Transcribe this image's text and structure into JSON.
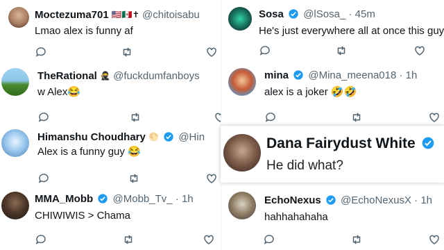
{
  "colors": {
    "verified": "#1d9bf0",
    "icon": "#536471",
    "text": "#0f1419",
    "muted": "#536471"
  },
  "tweets": [
    {
      "name": "Moctezuma701",
      "flags": "🇺🇸🇲🇽✝",
      "handle": "@chitoisabu",
      "time": "",
      "text": "Lmao alex is funny af",
      "verified": false
    },
    {
      "name": "Sosa",
      "flags": "",
      "handle": "@lSosa_",
      "time": "· 45m",
      "text": "He's just everywhere all at once this guy",
      "verified": true
    },
    {
      "name": "TheRational",
      "flags": "🥷",
      "handle": "@fuckdumfanboys",
      "time": "",
      "text": "w Alex😂",
      "verified": false
    },
    {
      "name": "mina",
      "flags": "",
      "handle": "@Mina_meena018",
      "time": "· 1h",
      "text": "alex is a joker 🤣🤣",
      "verified": true
    },
    {
      "name": "Himanshu Choudhary",
      "flags": "🌕",
      "handle": "@Hin",
      "time": "",
      "text": "Alex is a funny guy 😂",
      "verified": true
    },
    {
      "name": "MMA_Mobb",
      "flags": "",
      "handle": "@Mobb_Tv_",
      "time": "· 1h",
      "text": "CHIWIWIS > Chama",
      "verified": true
    },
    {
      "name": "EchoNexus",
      "flags": "",
      "handle": "@EchoNexusX",
      "time": "· 1h",
      "text": "hahhahahaha",
      "verified": true
    }
  ],
  "highlight": {
    "name": "Dana Fairydust White",
    "text": "He did what?"
  },
  "icons": {
    "reply": "reply-icon",
    "retweet": "retweet-icon",
    "like": "like-icon",
    "verified": "verified-badge-icon"
  }
}
